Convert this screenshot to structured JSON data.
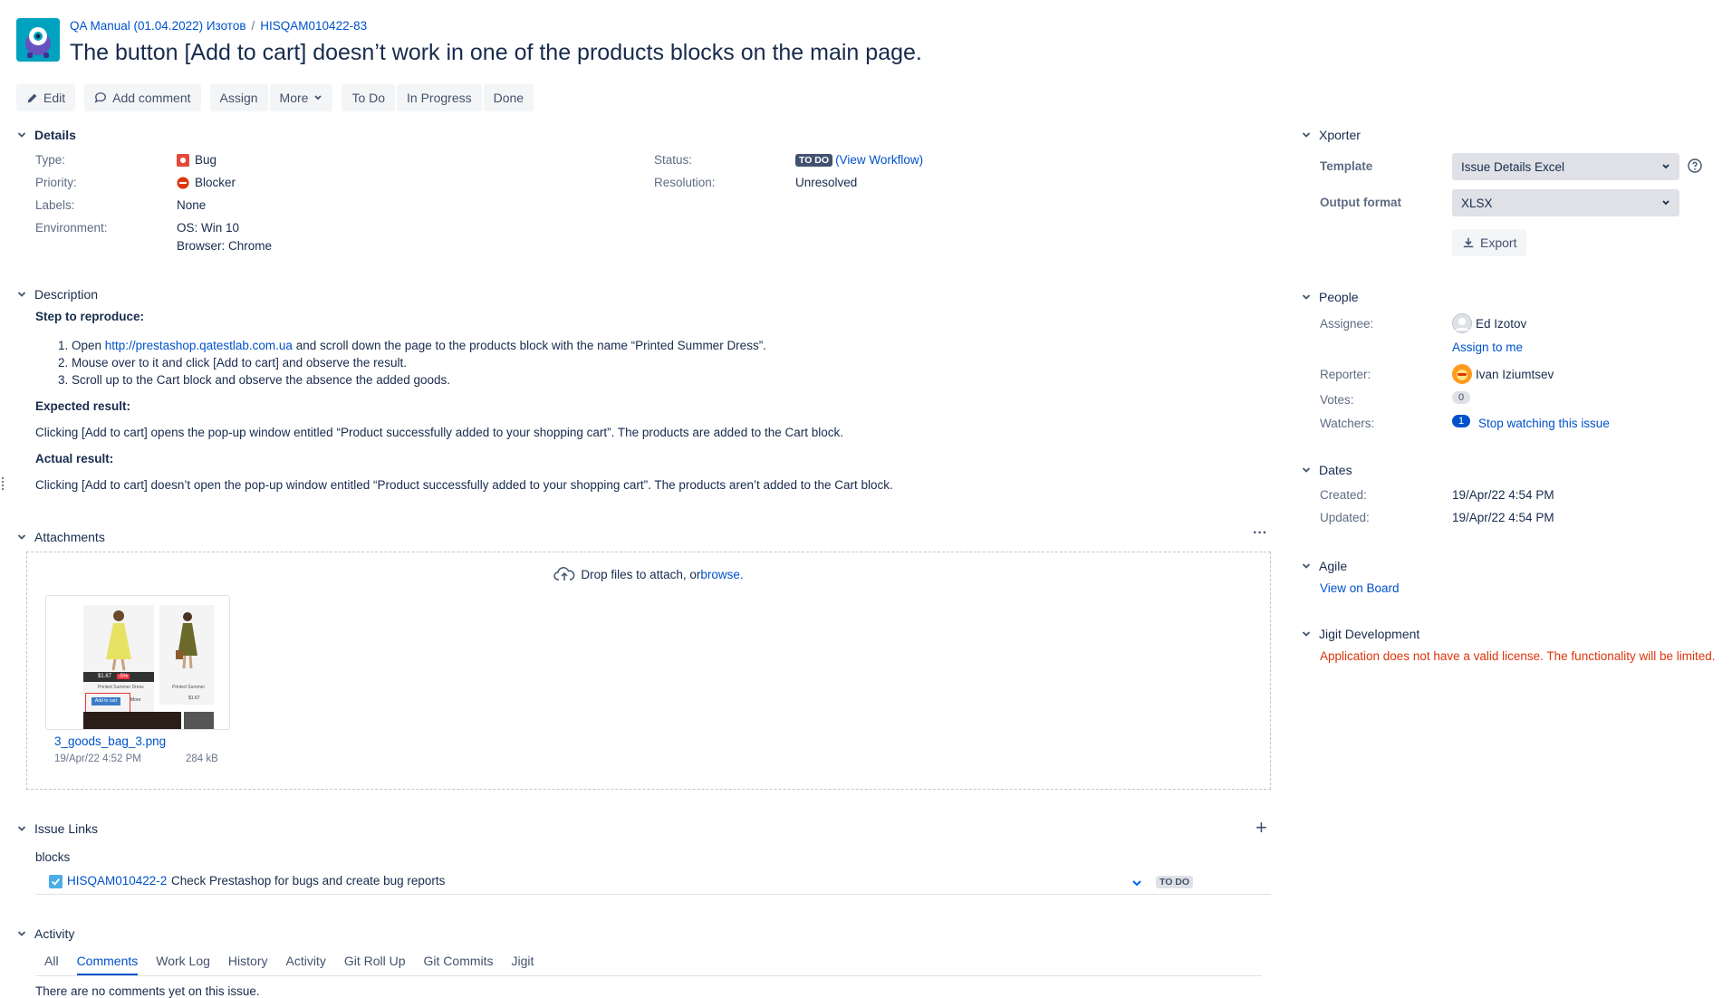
{
  "header": {
    "breadcrumb_project": "QA Manual (01.04.2022) Изотов",
    "breadcrumb_sep": "/",
    "breadcrumb_issue": "HISQAM010422-83",
    "title": "The button [Add to cart] doesn’t work in one of the products blocks on the main page."
  },
  "toolbar": {
    "edit": "Edit",
    "add_comment": "Add comment",
    "assign": "Assign",
    "more": "More",
    "todo": "To Do",
    "in_progress": "In Progress",
    "done": "Done"
  },
  "details": {
    "heading": "Details",
    "type_label": "Type:",
    "type_value": "Bug",
    "priority_label": "Priority:",
    "priority_value": "Blocker",
    "labels_label": "Labels:",
    "labels_value": "None",
    "environment_label": "Environment:",
    "environment_os": "OS: Win 10",
    "environment_browser": "Browser: Chrome",
    "status_label": "Status:",
    "status_value": "TO DO",
    "view_workflow": "(View Workflow)",
    "resolution_label": "Resolution:",
    "resolution_value": "Unresolved"
  },
  "description": {
    "heading": "Description",
    "steps_heading": "Step to reproduce:",
    "step1_prefix": "1. Open ",
    "step1_link": "http://prestashop.qatestlab.com.ua",
    "step1_suffix": " and scroll down the page to the products block with the name “Printed Summer Dress”.",
    "step2": "2. Mouse over to it and click [Add to cart] and observe the result.",
    "step3": "3. Scroll up to the Cart block and observe the absence the added goods.",
    "expected_heading": "Expected result:",
    "expected_text": "Clicking [Add to cart] opens the pop-up window entitled “Product successfully added to your shopping cart”. The products are added to the Cart block.",
    "actual_heading": "Actual result:",
    "actual_text": "Clicking [Add to cart] doesn’t open the pop-up window entitled “Product successfully added to your shopping cart”. The products aren’t added to the Cart block."
  },
  "attachments": {
    "heading": "Attachments",
    "more": "···",
    "drop_text": "Drop files to attach, or ",
    "browse": "browse.",
    "file_name": "3_goods_bag_3.png",
    "file_date": "19/Apr/22 4:52 PM",
    "file_size": "284 kB",
    "thumb_price1": "$1.67",
    "thumb_discount": "-5%",
    "thumb_name1": "Printed Summer Dress",
    "thumb_name2": "Printed Summer",
    "thumb_price2": "$1.67",
    "thumb_add": "Add to cart",
    "thumb_more": "More"
  },
  "issue_links": {
    "heading": "Issue Links",
    "add": "+",
    "relation": "blocks",
    "link_key": "HISQAM010422-2",
    "link_summary": "Check Prestashop for bugs and create bug reports",
    "link_status": "TO DO"
  },
  "activity": {
    "heading": "Activity",
    "tabs": [
      "All",
      "Comments",
      "Work Log",
      "History",
      "Activity",
      "Git Roll Up",
      "Git Commits",
      "Jigit"
    ],
    "empty": "There are no comments yet on this issue."
  },
  "xporter": {
    "heading": "Xporter",
    "template_label": "Template",
    "template_value": "Issue Details Excel",
    "output_label": "Output format",
    "output_value": "XLSX",
    "export": "Export"
  },
  "people": {
    "heading": "People",
    "assignee_label": "Assignee:",
    "assignee": "Ed Izotov",
    "assign_to_me": "Assign to me",
    "reporter_label": "Reporter:",
    "reporter": "Ivan Iziumtsev",
    "votes_label": "Votes:",
    "votes": "0",
    "watchers_label": "Watchers:",
    "watchers": "1",
    "stop_watching": "Stop watching this issue"
  },
  "dates": {
    "heading": "Dates",
    "created_label": "Created:",
    "created": "19/Apr/22 4:54 PM",
    "updated_label": "Updated:",
    "updated": "19/Apr/22 4:54 PM"
  },
  "agile": {
    "heading": "Agile",
    "view_on_board": "View on Board"
  },
  "jigit": {
    "heading": "Jigit Development",
    "warning": "Application does not have a valid license. The functionality will be limited."
  },
  "colors": {
    "link": "#0052cc",
    "bug": "#e5493a",
    "blocker": "#de350b",
    "error": "#de350b",
    "status_dark": "#42526e"
  }
}
